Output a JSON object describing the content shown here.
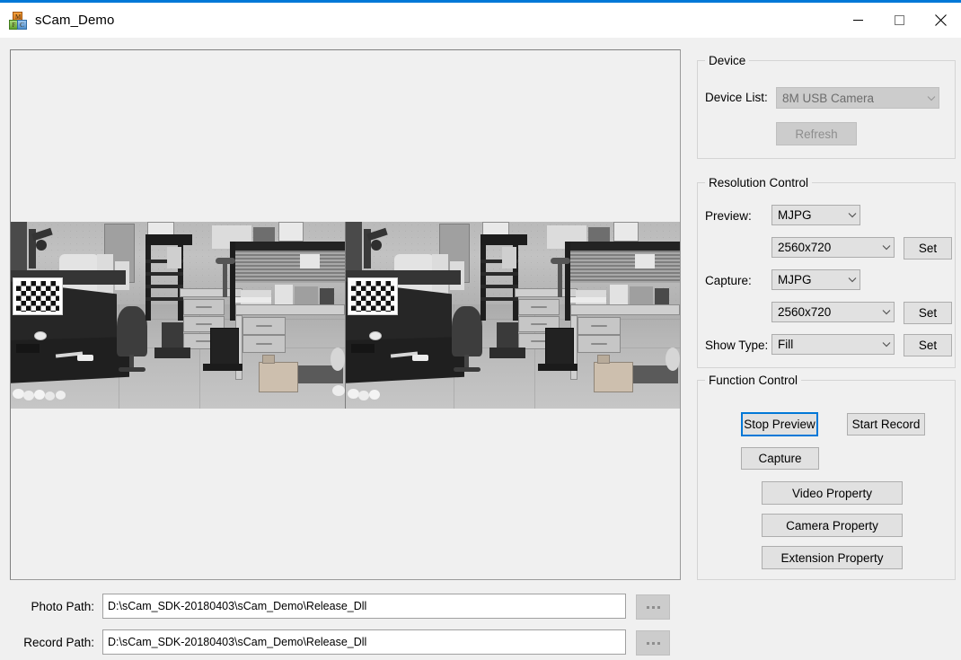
{
  "window": {
    "title": "sCam_Demo",
    "icon": "blocks-app-icon",
    "accent_color": "#0078d7",
    "background": "#f0f0f0",
    "controls": {
      "minimize": "minimize-icon",
      "maximize": "maximize-icon",
      "close": "close-icon"
    }
  },
  "preview": {
    "name": "video-preview-area",
    "description": "Grayscale stereo camera live preview: side-by-side left and right lens views of an office/lab room containing a dark workbench with a checkerboard calibration target, an office chair, desks with drawers, shelving, cardboard boxes and a tiled floor.",
    "mode": "stereo-side-by-side"
  },
  "device": {
    "legend": "Device",
    "device_list_label": "Device List:",
    "device_list_value": "8M USB Camera",
    "device_list_enabled": false,
    "refresh_label": "Refresh",
    "refresh_enabled": false
  },
  "resolution": {
    "legend": "Resolution Control",
    "preview_label": "Preview:",
    "preview_format": "MJPG",
    "preview_size": "2560x720",
    "preview_set_label": "Set",
    "capture_label": "Capture:",
    "capture_format": "MJPG",
    "capture_size": "2560x720",
    "capture_set_label": "Set",
    "show_type_label": "Show Type:",
    "show_type_value": "Fill",
    "show_type_set_label": "Set"
  },
  "functions": {
    "legend": "Function Control",
    "stop_preview_label": "Stop Preview",
    "stop_preview_focused": true,
    "start_record_label": "Start Record",
    "capture_label": "Capture",
    "video_property_label": "Video Property",
    "camera_property_label": "Camera Property",
    "extension_property_label": "Extension Property"
  },
  "paths": {
    "photo_label": "Photo Path:",
    "photo_value": "D:\\sCam_SDK-20180403\\sCam_Demo\\Release_Dll",
    "photo_browse_label": "...",
    "record_label": "Record Path:",
    "record_value": "D:\\sCam_SDK-20180403\\sCam_Demo\\Release_Dll",
    "record_browse_label": "..."
  }
}
